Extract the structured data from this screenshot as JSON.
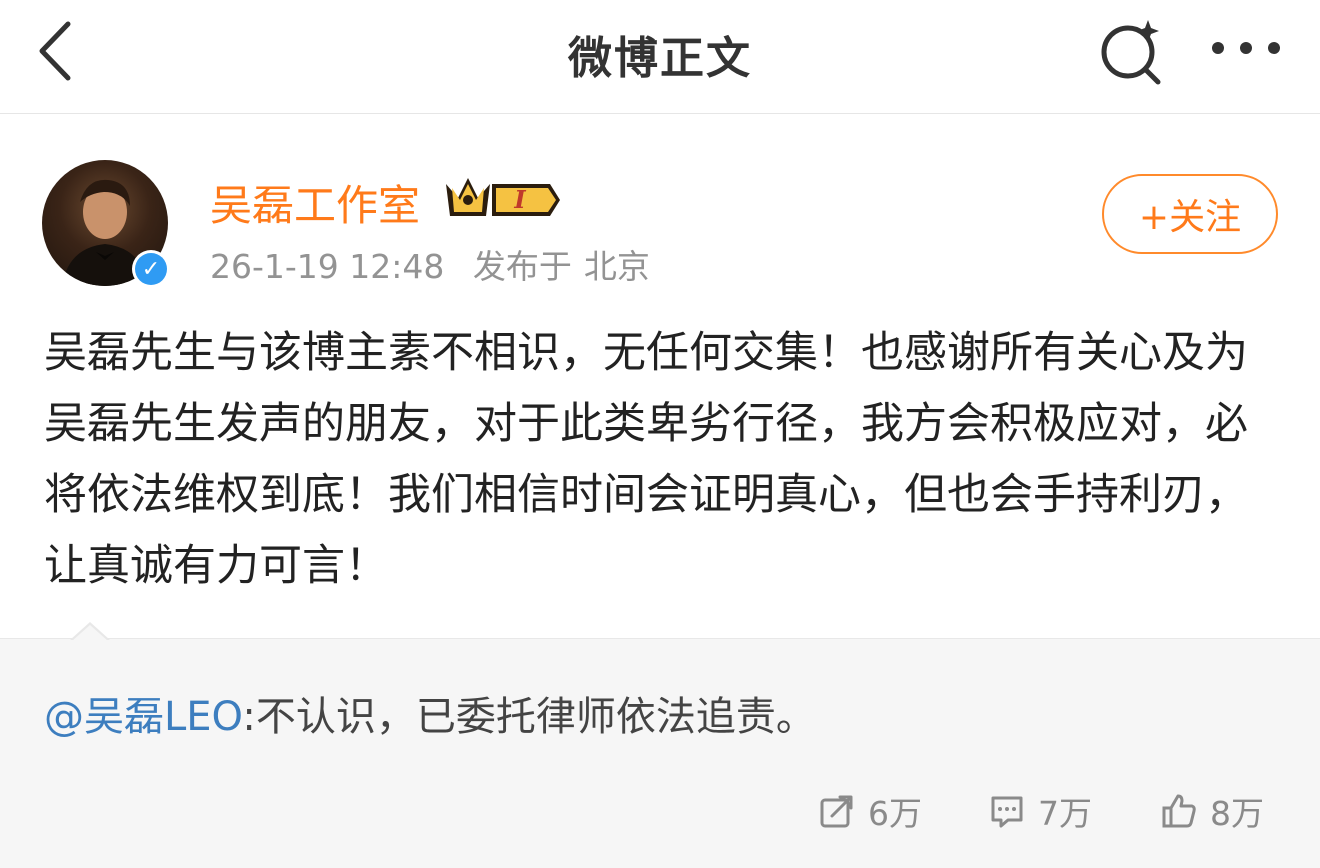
{
  "header": {
    "title": "微博正文"
  },
  "author": {
    "name": "吴磊工作室",
    "member_level": "I",
    "timestamp": "26-1-19 12:48",
    "location_prefix": "发布于",
    "location": "北京",
    "follow_label": "+关注"
  },
  "post": {
    "text": "吴磊先生与该博主素不相识，无任何交集！也感谢所有关心及为吴磊先生发声的朋友，对于此类卑劣行径，我方会积极应对，必将依法维权到底！我们相信时间会证明真心，但也会手持利刃，让真诚有力可言！"
  },
  "repost": {
    "mention": "@吴磊LEO",
    "text": ":不认识，已委托律师依法追责。"
  },
  "stats": {
    "reposts": "6万",
    "comments": "7万",
    "likes": "8万"
  },
  "colors": {
    "accent": "#ff7a1a",
    "link": "#3d7ebf",
    "verified": "#2f9bf3"
  }
}
